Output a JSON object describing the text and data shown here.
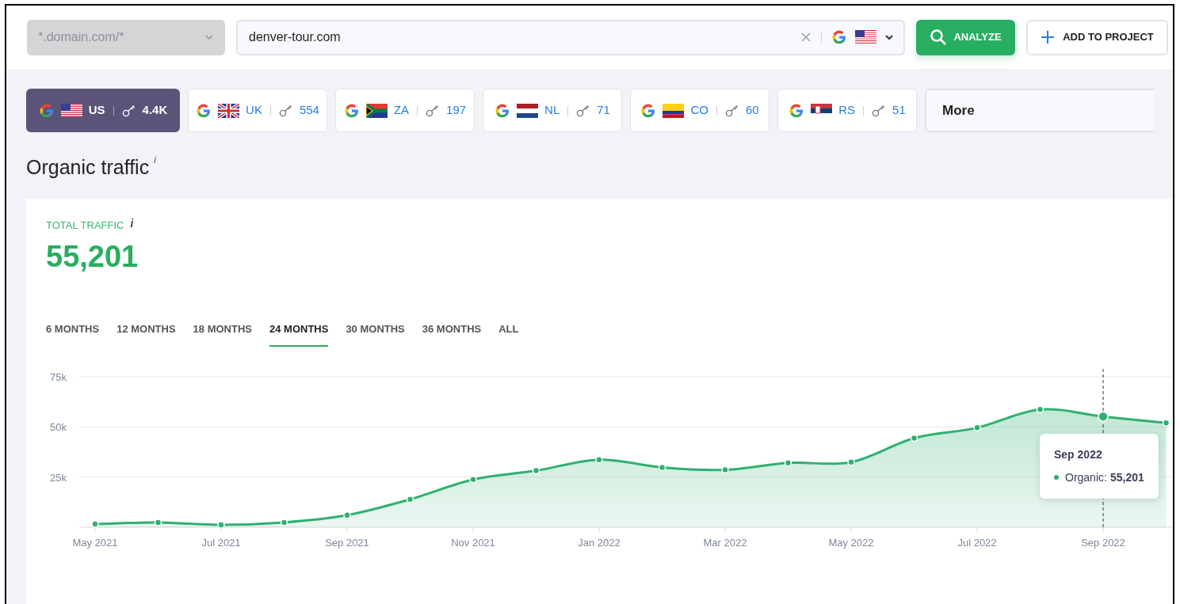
{
  "toolbar": {
    "scope_dropdown": {
      "placeholder": "*.domain.com/*"
    },
    "search": {
      "value": "denver-tour.com",
      "kind": "us"
    },
    "analyze_button": "ANALYZE",
    "add_button": "ADD TO PROJECT"
  },
  "country_tabs": [
    {
      "code": "US",
      "kind": "us",
      "keywords": "4.4K",
      "selected": true
    },
    {
      "code": "UK",
      "kind": "uk",
      "keywords": "554",
      "selected": false
    },
    {
      "code": "ZA",
      "kind": "za",
      "keywords": "197",
      "selected": false
    },
    {
      "code": "NL",
      "kind": "nl",
      "keywords": "71",
      "selected": false
    },
    {
      "code": "CO",
      "kind": "co",
      "keywords": "60",
      "selected": false
    },
    {
      "code": "RS",
      "kind": "rs",
      "keywords": "51",
      "selected": false
    }
  ],
  "more_dropdown": "More",
  "section_title": "Organic traffic",
  "section_info": "i",
  "card": {
    "label": "TOTAL TRAFFIC",
    "info": "i",
    "total": "55,201",
    "periods": [
      {
        "label": "6 MONTHS",
        "selected": false
      },
      {
        "label": "12 MONTHS",
        "selected": false
      },
      {
        "label": "18 MONTHS",
        "selected": false
      },
      {
        "label": "24 MONTHS",
        "selected": true
      },
      {
        "label": "30 MONTHS",
        "selected": false
      },
      {
        "label": "36 MONTHS",
        "selected": false
      },
      {
        "label": "ALL",
        "selected": false
      }
    ],
    "chart_data": {
      "type": "area",
      "categories": [
        "May 2021",
        null,
        "Jul 2021",
        null,
        "Sep 2021",
        null,
        "Nov 2021",
        null,
        "Jan 2022",
        null,
        "Mar 2022",
        null,
        "May 2022",
        null,
        "Jul 2022",
        null,
        "Sep 2022",
        null
      ],
      "series": [
        {
          "color": "#2fb070",
          "values": [
            1600,
            2400,
            1200,
            2400,
            6000,
            13900,
            23800,
            28200,
            33700,
            29800,
            28600,
            32100,
            32500,
            44400,
            49600,
            58700,
            55200,
            52000
          ]
        }
      ],
      "ylim": [
        0,
        75000
      ],
      "yticks": [
        {
          "value": 25000,
          "label": "25k"
        },
        {
          "value": 50000,
          "label": "50k"
        },
        {
          "value": 75000,
          "label": "75k"
        }
      ]
    },
    "tooltip": {
      "title": "Sep 2022",
      "label": "Organic:",
      "value": "55,201"
    }
  }
}
